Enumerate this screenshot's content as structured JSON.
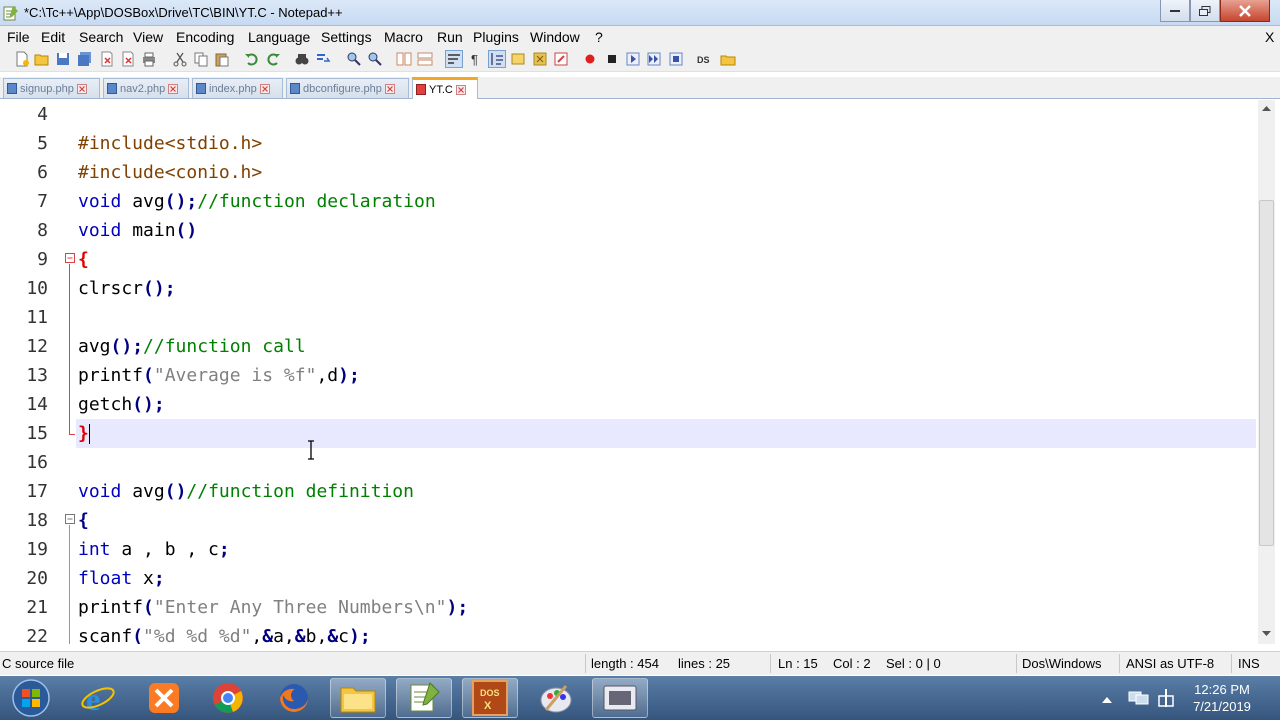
{
  "window": {
    "title": "*C:\\Tc++\\App\\DOSBox\\Drive\\TC\\BIN\\YT.C - Notepad++",
    "close_x": "X"
  },
  "menu": [
    "File",
    "Edit",
    "Search",
    "View",
    "Encoding",
    "Language",
    "Settings",
    "Macro",
    "Run",
    "Plugins",
    "Window",
    "?"
  ],
  "tabs": [
    {
      "label": "signup.php",
      "active": false
    },
    {
      "label": "nav2.php",
      "active": false
    },
    {
      "label": "index.php",
      "active": false
    },
    {
      "label": "dbconfigure.php",
      "active": false
    },
    {
      "label": "YT.C",
      "active": true
    }
  ],
  "lines": [
    {
      "n": "4",
      "code": ""
    },
    {
      "n": "5",
      "code": "#include<stdio.h>"
    },
    {
      "n": "6",
      "code": "#include<conio.h>"
    },
    {
      "n": "7",
      "code": "void avg();//function declaration"
    },
    {
      "n": "8",
      "code": "void main()"
    },
    {
      "n": "9",
      "code": "{"
    },
    {
      "n": "10",
      "code": "clrscr();"
    },
    {
      "n": "11",
      "code": ""
    },
    {
      "n": "12",
      "code": "avg();//function call"
    },
    {
      "n": "13",
      "code": "printf(\"Average is %f\",d);"
    },
    {
      "n": "14",
      "code": "getch();"
    },
    {
      "n": "15",
      "code": "}"
    },
    {
      "n": "16",
      "code": ""
    },
    {
      "n": "17",
      "code": "void avg()//function definition"
    },
    {
      "n": "18",
      "code": "{"
    },
    {
      "n": "19",
      "code": "int a , b , c;"
    },
    {
      "n": "20",
      "code": "float x;"
    },
    {
      "n": "21",
      "code": "printf(\"Enter Any Three Numbers\\n\");"
    },
    {
      "n": "22",
      "code": "scanf(\"%d %d %d\",&a,&b,&c);"
    }
  ],
  "status": {
    "file_type": "C source file",
    "length": "length : 454",
    "lines": "lines : 25",
    "ln": "Ln : 15",
    "col": "Col : 2",
    "sel": "Sel : 0 | 0",
    "eol": "Dos\\Windows",
    "encoding": "ANSI as UTF-8",
    "mode": "INS"
  },
  "clock": {
    "time": "12:26 PM",
    "date": "7/21/2019"
  },
  "colors": {
    "accent": "#f5a623",
    "keyword": "#0000c0",
    "comment": "#008000",
    "string": "#808080",
    "brace": "#e00000"
  }
}
